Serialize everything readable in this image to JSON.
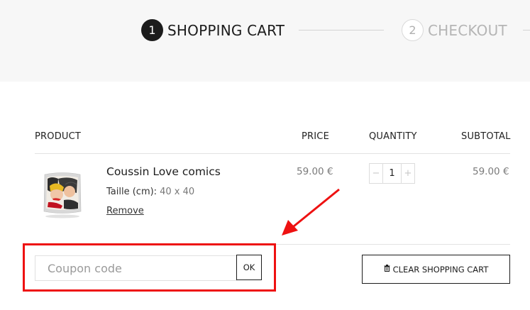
{
  "steps": [
    {
      "num": "1",
      "label": "SHOPPING CART",
      "state": "active"
    },
    {
      "num": "2",
      "label": "CHECKOUT",
      "state": "inactive"
    }
  ],
  "table": {
    "headers": {
      "product": "PRODUCT",
      "price": "PRICE",
      "quantity": "QUANTITY",
      "subtotal": "SUBTOTAL"
    },
    "rows": [
      {
        "name": "Coussin Love comics",
        "variation_label": "Taille (cm):",
        "variation_value": "40 x 40",
        "remove_label": "Remove",
        "price": "59.00 €",
        "quantity": "1",
        "subtotal": "59.00 €",
        "qty_minus": "−",
        "qty_plus": "+"
      }
    ]
  },
  "coupon": {
    "placeholder": "Coupon code",
    "apply_label": "OK"
  },
  "clear_cart": {
    "icon": "trash-icon",
    "label": "CLEAR SHOPPING CART"
  },
  "annotation": {
    "color": "#ee1111"
  },
  "colors": {
    "accent": "#1c1c1c",
    "muted": "#b5b5b5",
    "highlight": "#ee1111"
  }
}
